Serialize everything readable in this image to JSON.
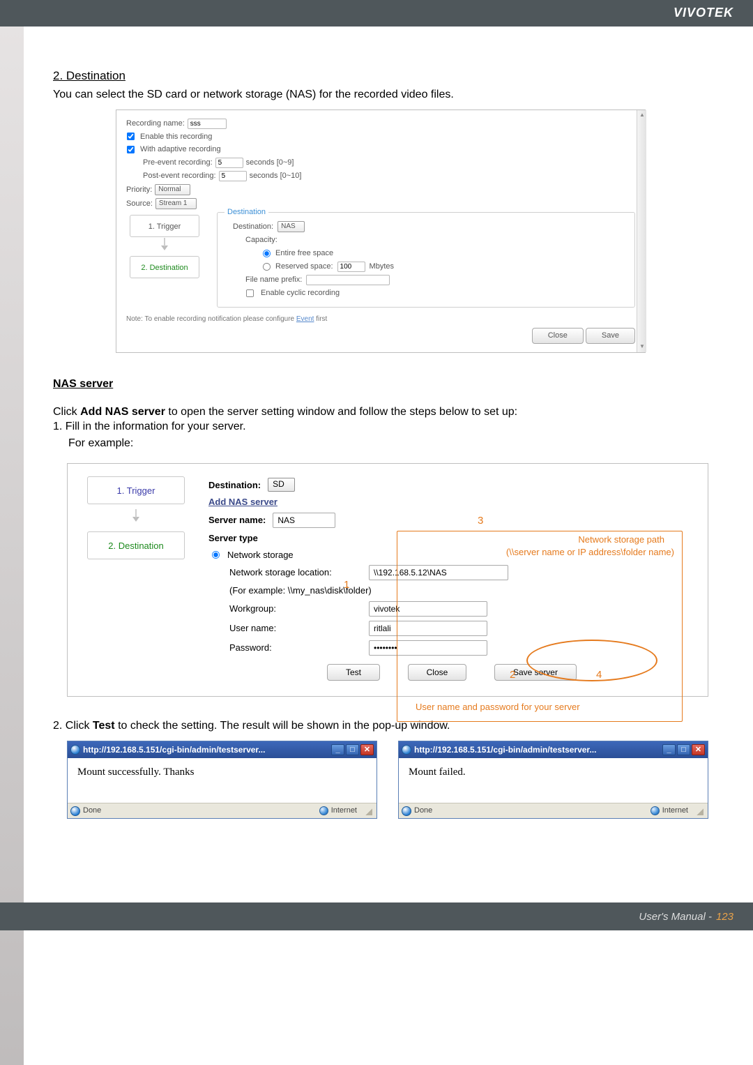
{
  "brand": "VIVOTEK",
  "section_title": "2. Destination",
  "intro": "You can select the SD card or network storage (NAS) for the recorded video files.",
  "panel1": {
    "recording_name_label": "Recording name:",
    "recording_name_value": "sss",
    "enable_recording": "Enable this recording",
    "adaptive": "With adaptive recording",
    "pre_label": "Pre-event recording:",
    "pre_value": "5",
    "pre_suffix": "seconds [0~9]",
    "post_label": "Post-event recording:",
    "post_value": "5",
    "post_suffix": "seconds [0~10]",
    "priority_label": "Priority:",
    "priority_value": "Normal",
    "source_label": "Source:",
    "source_value": "Stream 1",
    "tab_trigger": "1. Trigger",
    "tab_dest": "2. Destination",
    "legend": "Destination",
    "dest_label": "Destination:",
    "dest_value": "NAS",
    "capacity_label": "Capacity:",
    "entire_free": "Entire free space",
    "reserved_label": "Reserved space:",
    "reserved_value": "100",
    "reserved_unit": "Mbytes",
    "prefix_label": "File name prefix:",
    "cyclic": "Enable cyclic recording",
    "note_prefix": "Note: To enable recording notification please configure ",
    "note_link": "Event",
    "note_suffix": " first",
    "btn_close": "Close",
    "btn_save": "Save"
  },
  "nas_heading": "NAS server",
  "nas_intro_prefix": "Click ",
  "nas_intro_bold": "Add NAS server",
  "nas_intro_suffix": " to open the server setting window and follow the steps below to set up:",
  "nas_step1": "1. Fill in the information for your server.",
  "nas_step1_sub": "For example:",
  "panel2": {
    "tab_trigger": "1. Trigger",
    "tab_dest": "2. Destination",
    "dest_label": "Destination:",
    "dest_value": "SD",
    "add_nas": "Add NAS server",
    "server_name_label": "Server name:",
    "server_name_value": "NAS",
    "server_type_label": "Server type",
    "network_storage": "Network storage",
    "nsl_label": "Network storage location:",
    "nsl_value": "\\\\192.168.5.12\\NAS",
    "nsl_example": "(For example: \\\\my_nas\\disk\\folder)",
    "workgroup_label": "Workgroup:",
    "workgroup_value": "vivotek",
    "username_label": "User name:",
    "username_value": "ritlali",
    "password_label": "Password:",
    "password_value": "••••••••",
    "btn_test": "Test",
    "btn_close": "Close",
    "btn_save": "Save server",
    "callout_net_label": "Network storage path",
    "callout_net_sub": "(\\\\server name or IP address\\folder name)",
    "anno1": "1",
    "anno2": "2",
    "anno3": "3",
    "anno4": "4"
  },
  "footnote_caption": "User name and password for your server",
  "step2_prefix": "2. Click ",
  "step2_bold": "Test",
  "step2_suffix": " to check the setting. The result will be shown in the pop-up window.",
  "popup": {
    "url": "http://192.168.5.151/cgi-bin/admin/testserver...",
    "success_body": "Mount successfully. Thanks",
    "fail_body": "Mount failed.",
    "status_done": "Done",
    "status_zone": "Internet"
  },
  "footer_label": "User's Manual - ",
  "footer_page": "123"
}
